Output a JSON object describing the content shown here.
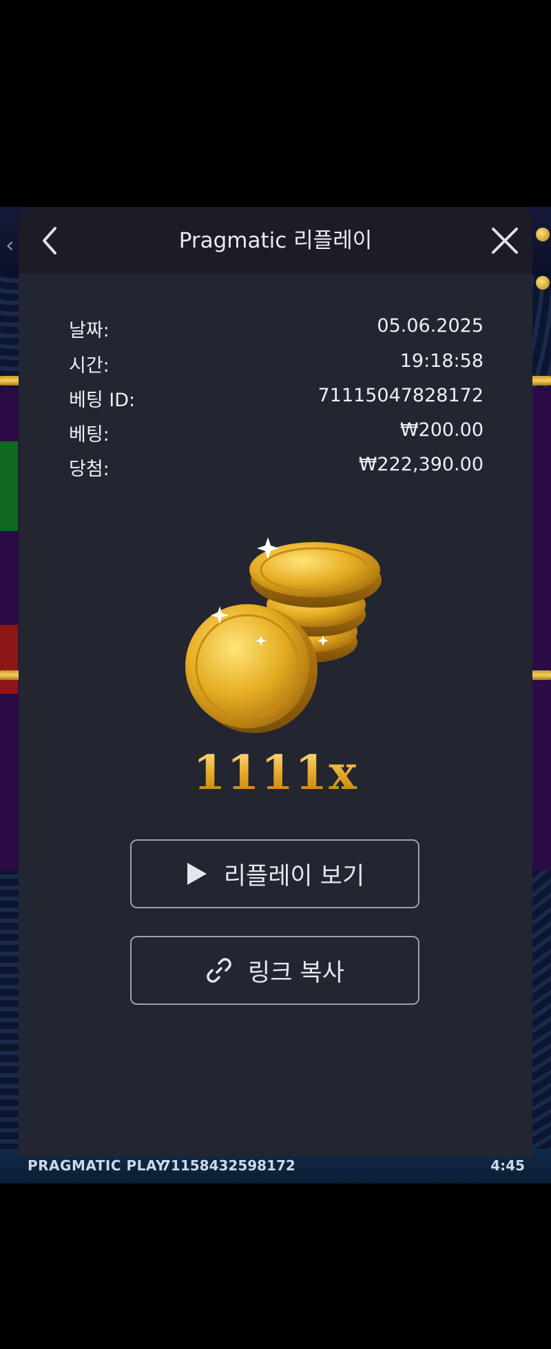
{
  "background": {
    "provider_label": "PRAGMATIC PLAY",
    "round_id": "71158432598172",
    "clock": "4:45"
  },
  "modal": {
    "title": "Pragmatic 리플레이",
    "back_icon": "chevron-left-icon",
    "close_icon": "close-icon"
  },
  "details": [
    {
      "label": "날짜:",
      "value": "05.06.2025"
    },
    {
      "label": "시간:",
      "value": "19:18:58"
    },
    {
      "label": "베팅 ID:",
      "value": "71115047828172"
    },
    {
      "label": "베팅:",
      "value": "₩200.00"
    },
    {
      "label": "당첨:",
      "value": "₩222,390.00"
    }
  ],
  "win": {
    "multiplier": "1111x",
    "icon": "gold-coins-icon"
  },
  "actions": {
    "replay_label": "리플레이 보기",
    "replay_icon": "play-icon",
    "copy_label": "링크 복사",
    "copy_icon": "link-icon"
  },
  "colors": {
    "modal_bg": "#232531",
    "header_bg": "#1b1c25",
    "gold": "#e3a422"
  }
}
